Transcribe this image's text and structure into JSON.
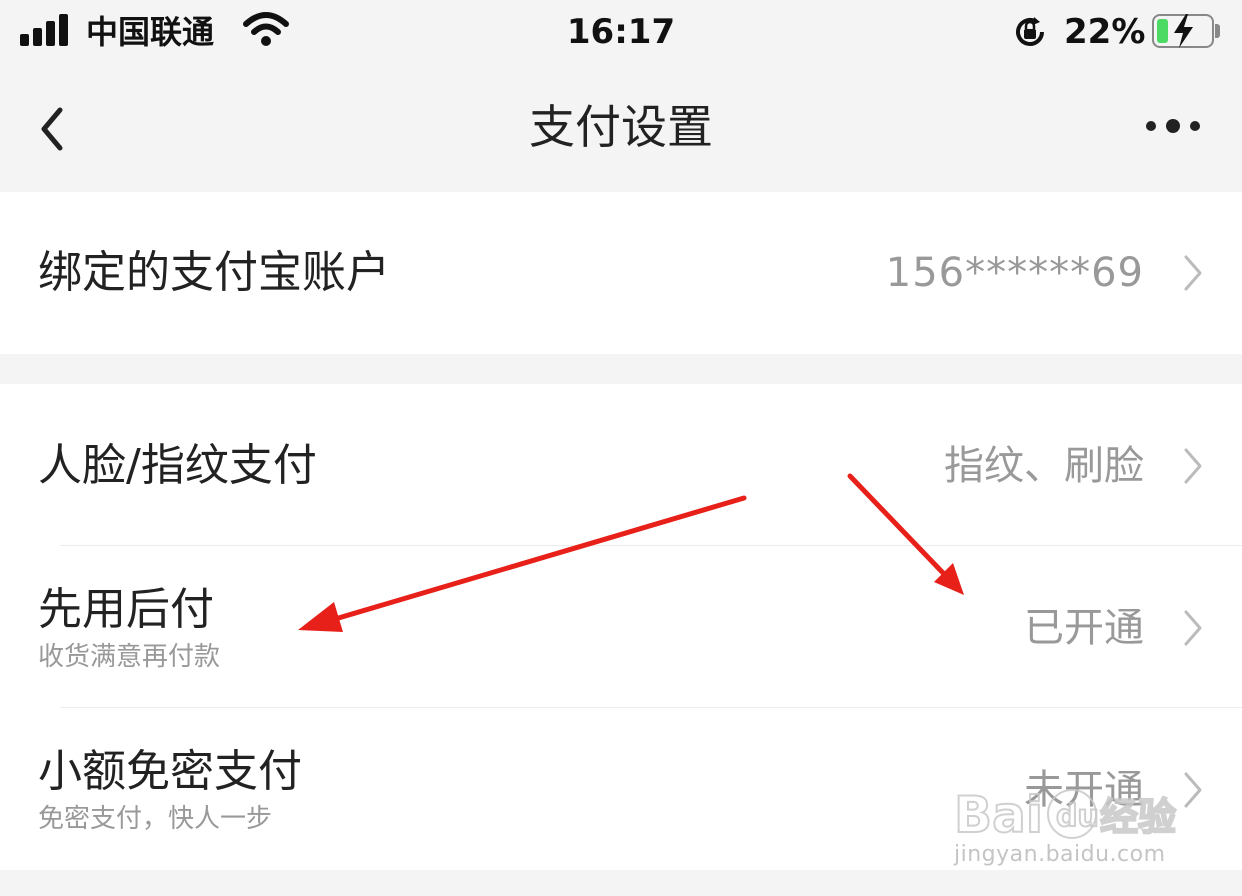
{
  "status_bar": {
    "carrier": "中国联通",
    "time": "16:17",
    "battery_percent": "22%",
    "battery_level": 0.22,
    "charging": true
  },
  "nav": {
    "title": "支付设置",
    "back_icon": "chevron-left-icon",
    "more_icon": "more-dots-icon"
  },
  "settings": {
    "alipay_account": {
      "label": "绑定的支付宝账户",
      "value": "156******69"
    },
    "biometric_pay": {
      "label": "人脸/指纹支付",
      "value": "指纹、刷脸"
    },
    "pay_later": {
      "label": "先用后付",
      "subtitle": "收货满意再付款",
      "value": "已开通"
    },
    "small_password_free": {
      "label": "小额免密支付",
      "subtitle": "免密支付，快人一步",
      "value": "未开通"
    }
  },
  "watermark": {
    "logo_text": "Baidu经验",
    "url": "jingyan.baidu.com"
  },
  "colors": {
    "background": "#f4f4f4",
    "card": "#ffffff",
    "value_text": "#999999",
    "annotation_arrow": "#e8201a",
    "battery_green": "#4cd964"
  }
}
